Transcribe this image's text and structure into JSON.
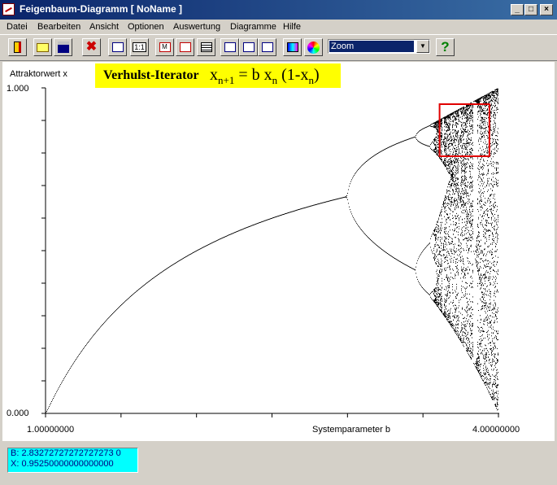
{
  "window": {
    "title": "Feigenbaum-Diagramm [ NoName ]",
    "min_label": "_",
    "max_label": "□",
    "close_label": "×"
  },
  "menu": [
    "Datei",
    "Bearbeiten",
    "Ansicht",
    "Optionen",
    "Auswertung",
    "Diagramme",
    "Hilfe"
  ],
  "toolbar": {
    "zoom_value": "Zoom",
    "help_label": "?",
    "buttons": [
      "exit-icon",
      "open-folder-icon",
      "save-disk-icon",
      "delete-x-icon",
      "chart-axes-icon",
      "scale-1-1-icon",
      "marker-m-icon",
      "frame-icon",
      "table-icon",
      "chart-line-a-icon",
      "chart-line-b-icon",
      "chart-line-c-icon",
      "hsv-icon",
      "color-wheel-icon"
    ]
  },
  "formula": {
    "label": "Verhulst-Iterator",
    "x": "x",
    "sub_n1": "n+1",
    "eq": " = b x",
    "sub_n": "n",
    "paren": " (1-x",
    "sub_n2": "n",
    "close": ")"
  },
  "chart_data": {
    "type": "scatter",
    "title": "",
    "ylabel": "Attraktorwert x",
    "xlabel": "Systemparameter b",
    "xlim": [
      1.0,
      4.0
    ],
    "ylim": [
      0.0,
      1.0
    ],
    "x_tick_labels": [
      "1.00000000",
      "4.00000000"
    ],
    "y_tick_labels": [
      "1.000",
      "0.000"
    ],
    "equation": "x(n+1) = b x(n) (1 - x(n))",
    "zoom_region": {
      "b": [
        3.61,
        3.94
      ],
      "x": [
        0.79,
        0.95
      ],
      "color": "#e00000"
    }
  },
  "status": {
    "b_line": "B: 2.83272727272727273 0",
    "x_line": "X: 0.95250000000000000"
  },
  "colors": {
    "titlebar": "#0a246a",
    "formula_bg": "#ffff00",
    "status_bg": "#00ffff",
    "zoom_rect": "#e00000"
  }
}
